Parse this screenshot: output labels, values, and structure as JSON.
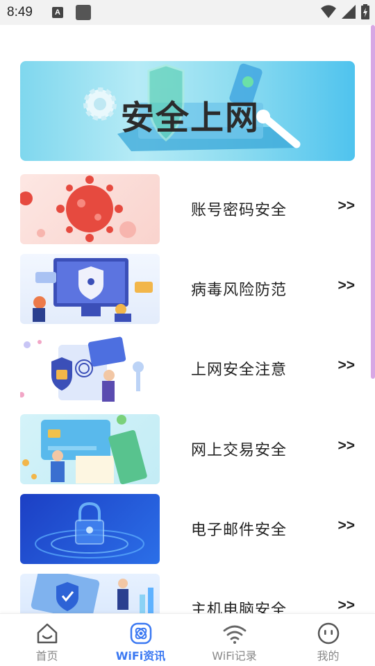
{
  "status_bar": {
    "time": "8:49",
    "a_badge": "A"
  },
  "banner": {
    "title": "安全上网"
  },
  "list": [
    {
      "title": "账号密码安全",
      "arrow": ">>"
    },
    {
      "title": "病毒风险防范",
      "arrow": ">>"
    },
    {
      "title": "上网安全注意",
      "arrow": ">>"
    },
    {
      "title": "网上交易安全",
      "arrow": ">>"
    },
    {
      "title": "电子邮件安全",
      "arrow": ">>"
    },
    {
      "title": "主机电脑安全",
      "arrow": ">>"
    }
  ],
  "bottom_nav": [
    {
      "label": "首页",
      "icon": "home-icon"
    },
    {
      "label": "WiFi资讯",
      "icon": "wifi-info-icon",
      "active": true
    },
    {
      "label": "WiFi记录",
      "icon": "wifi-icon"
    },
    {
      "label": "我的",
      "icon": "face-icon"
    }
  ],
  "colors": {
    "active_nav": "#3a78f2",
    "inactive_nav": "#888888",
    "scroll_indicator": "#d8a7e4"
  }
}
